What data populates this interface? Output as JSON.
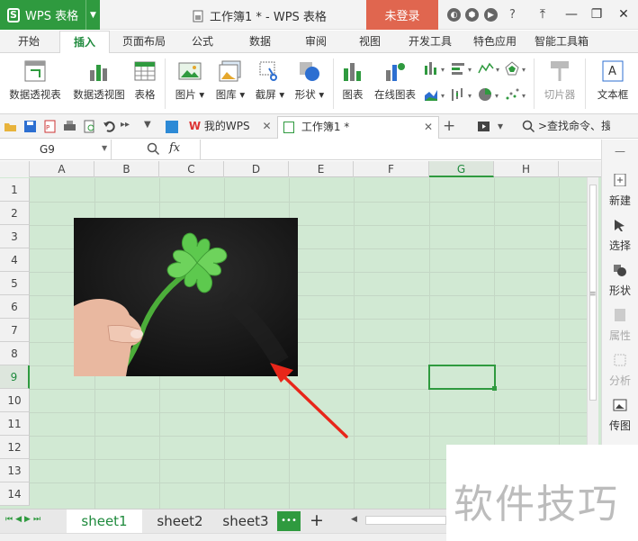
{
  "app": {
    "name": "WPS 表格",
    "logo": "S"
  },
  "window": {
    "title": "工作簿1 * - WPS 表格",
    "login_label": "未登录"
  },
  "menu": [
    "开始",
    "插入",
    "页面布局",
    "公式",
    "数据",
    "审阅",
    "视图",
    "开发工具",
    "特色应用",
    "智能工具箱"
  ],
  "menu_active": "插入",
  "ribbon": {
    "pivot_table": "数据透视表",
    "pivot_chart": "数据透视图",
    "table": "表格",
    "picture": "图片",
    "gallery": "图库",
    "screenshot": "截屏",
    "shape": "形状",
    "chart": "图表",
    "online_chart": "在线图表",
    "slicer": "切片器",
    "textbox": "文本框"
  },
  "tabs": {
    "mywps": "我的WPS",
    "workbook": "工作簿1 *",
    "search": ">查找命令、搜索..."
  },
  "formula": {
    "cell_ref": "G9",
    "fx": "fx",
    "value": ""
  },
  "columns": [
    "A",
    "B",
    "C",
    "D",
    "E",
    "F",
    "G",
    "H"
  ],
  "rows": [
    "1",
    "2",
    "3",
    "4",
    "5",
    "6",
    "7",
    "8",
    "9",
    "10",
    "11",
    "12",
    "13",
    "14"
  ],
  "selected": {
    "column": "G",
    "row": "9"
  },
  "sidebar": [
    "新建",
    "选择",
    "形状",
    "属性",
    "分析",
    "传图"
  ],
  "sheets": [
    "sheet1",
    "sheet2",
    "sheet3"
  ],
  "active_sheet": "sheet1",
  "sheet_more": "•••",
  "watermark": "软件技巧",
  "colors": {
    "accent": "#2f9a3f",
    "grid_bg": "#d1e9d3",
    "login": "#e0664f",
    "arrow": "#e8261a"
  }
}
